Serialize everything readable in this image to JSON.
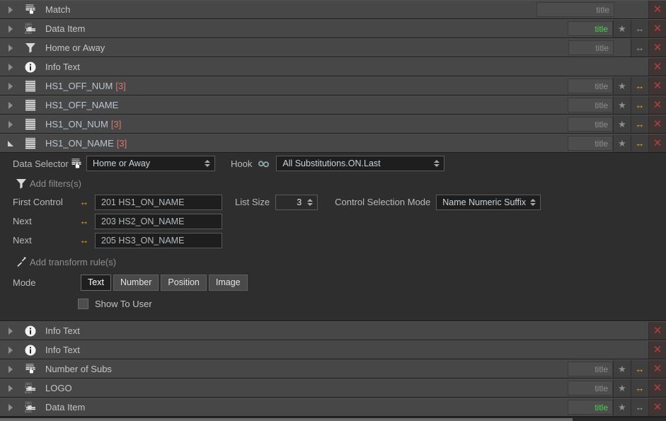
{
  "rows_top": [
    {
      "label": "Match",
      "count": "",
      "icon": "match-icon",
      "expanded": false,
      "title": {
        "show": true,
        "text": "title",
        "green": false,
        "wide": true
      },
      "star": false,
      "arrow": "none",
      "close": true
    },
    {
      "label": "Data Item",
      "count": "",
      "icon": "data-item-icon",
      "expanded": false,
      "title": {
        "show": true,
        "text": "title",
        "green": true,
        "wide": false
      },
      "star": true,
      "arrow": "gray",
      "close": true
    },
    {
      "label": "Home or Away",
      "count": "",
      "icon": "filter-funnel-icon",
      "expanded": false,
      "title": {
        "show": true,
        "text": "title",
        "green": false,
        "wide": false
      },
      "star": false,
      "arrow": "gray",
      "close": true
    },
    {
      "label": "Info Text",
      "count": "",
      "icon": "info-icon",
      "expanded": false,
      "title": {
        "show": false,
        "text": "",
        "green": false,
        "wide": false
      },
      "star": false,
      "arrow": "none",
      "close": true
    },
    {
      "label": "HS1_OFF_NUM",
      "count": "[3]",
      "icon": "list-icon",
      "expanded": false,
      "title": {
        "show": true,
        "text": "title",
        "green": false,
        "wide": false
      },
      "star": true,
      "arrow": "orange",
      "close": true
    },
    {
      "label": "HS1_OFF_NAME",
      "count": "",
      "icon": "list-icon",
      "expanded": false,
      "title": {
        "show": true,
        "text": "title",
        "green": false,
        "wide": false
      },
      "star": true,
      "arrow": "orange",
      "close": true
    },
    {
      "label": "HS1_ON_NUM",
      "count": "[3]",
      "icon": "list-icon",
      "expanded": false,
      "title": {
        "show": true,
        "text": "title",
        "green": false,
        "wide": false
      },
      "star": true,
      "arrow": "orange",
      "close": true
    },
    {
      "label": "HS1_ON_NAME",
      "count": "[3]",
      "icon": "list-icon",
      "expanded": true,
      "title": {
        "show": true,
        "text": "title",
        "green": false,
        "wide": false
      },
      "star": true,
      "arrow": "orange",
      "close": true
    }
  ],
  "panel": {
    "data_selector_label": "Data Selector",
    "data_selector_value": "Home or Away",
    "hook_label": "Hook",
    "hook_value": "All Substitutions.ON.Last",
    "add_filters_label": "Add filters(s)",
    "first_control_label": "First Control",
    "next_label_1": "Next",
    "next_label_2": "Next",
    "control_1": "201 HS1_ON_NAME",
    "control_2": "203 HS2_ON_NAME",
    "control_3": "205 HS3_ON_NAME",
    "list_size_label": "List Size",
    "list_size_value": "3",
    "control_selection_mode_label": "Control Selection Mode",
    "control_selection_mode_value": "Name Numeric Suffix",
    "add_transform_label": "Add transform rule(s)",
    "mode_label": "Mode",
    "mode_options": [
      "Text",
      "Number",
      "Position",
      "Image"
    ],
    "mode_selected": "Text",
    "show_to_user_label": "Show To User",
    "show_to_user_checked": false
  },
  "rows_bottom": [
    {
      "label": "Info Text",
      "count": "",
      "icon": "info-icon",
      "expanded": false,
      "title": {
        "show": false,
        "text": "",
        "green": false,
        "wide": false
      },
      "star": false,
      "arrow": "none",
      "close": true
    },
    {
      "label": "Info Text",
      "count": "",
      "icon": "info-icon",
      "expanded": false,
      "title": {
        "show": false,
        "text": "",
        "green": false,
        "wide": false
      },
      "star": false,
      "arrow": "none",
      "close": true
    },
    {
      "label": "Number of Subs",
      "count": "",
      "icon": "match-icon",
      "expanded": false,
      "title": {
        "show": true,
        "text": "title",
        "green": false,
        "wide": false
      },
      "star": true,
      "arrow": "orange",
      "close": true
    },
    {
      "label": "LOGO",
      "count": "",
      "icon": "data-item-icon",
      "expanded": false,
      "title": {
        "show": true,
        "text": "title",
        "green": false,
        "wide": false
      },
      "star": true,
      "arrow": "orange",
      "close": true
    },
    {
      "label": "Data Item",
      "count": "",
      "icon": "data-item-icon",
      "expanded": false,
      "title": {
        "show": true,
        "text": "title",
        "green": true,
        "wide": false
      },
      "star": true,
      "arrow": "gray",
      "close": true
    }
  ],
  "colors": {
    "row_bg": "#474747",
    "panel_bg": "#2e2e2e",
    "accent_orange": "#e8a317",
    "accent_green": "#49d14b",
    "accent_red": "#b2403c",
    "label_blue": "#b9c4cf",
    "count_red": "#d07b6c"
  },
  "icons": {
    "star": "★",
    "double_arrow": "↔",
    "close": "✕",
    "hook": "∞"
  }
}
